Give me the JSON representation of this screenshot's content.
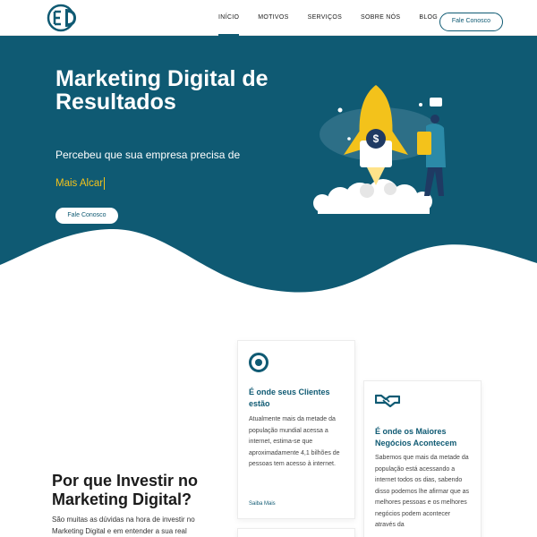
{
  "header": {
    "nav": [
      "INÍCIO",
      "MOTIVOS",
      "SERVIÇOS",
      "SOBRE NÓS",
      "BLOG"
    ],
    "cta_label": "Fale Conosco"
  },
  "hero": {
    "title": "Marketing Digital de Resultados",
    "subtitle": "Percebeu que sua empresa precisa de",
    "rotating_text": "Mais Alcar",
    "cta_label": "Fale Conosco"
  },
  "section": {
    "title": "Por que Investir no Marketing Digital?",
    "text": "São muitas as dúvidas na hora de investir no Marketing Digital e em entender a sua real"
  },
  "cards": [
    {
      "icon": "target-icon",
      "title": "É onde seus Clientes estão",
      "text": "Atualmente mais da metade da população mundial acessa a internet, estima-se que aproximadamente 4,1 bilhões de pessoas tem acesso à internet.",
      "link": "Saiba Mais"
    },
    {
      "icon": "handshake-icon",
      "title": "É onde os Maiores Negócios Acontecem",
      "text": "Sabemos que mais da metade da população está acessando a internet todos os dias, sabendo disso podemos lhe afirmar que as melhores pessoas e os melhores negócios podem acontecer através da"
    }
  ],
  "colors": {
    "primary": "#0f5a73",
    "accent": "#f3c21b",
    "background": "#ffffff"
  }
}
